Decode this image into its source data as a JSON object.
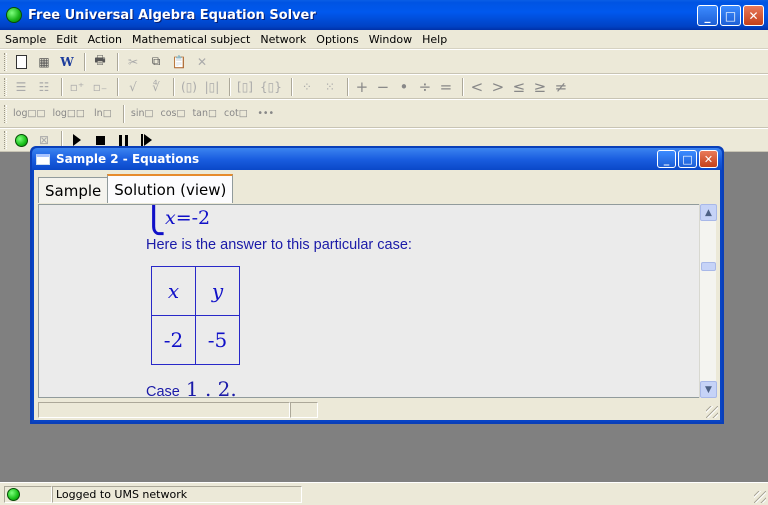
{
  "window": {
    "title": "Free Universal Algebra Equation Solver",
    "buttons": {
      "minimize": "_",
      "maximize": "□",
      "close": "✕"
    }
  },
  "menu": [
    "Sample",
    "Edit",
    "Action",
    "Mathematical subject",
    "Network",
    "Options",
    "Window",
    "Help"
  ],
  "toolbar": {
    "row1": [
      "new-document",
      "grid",
      "word-export",
      "print-preview",
      "cut",
      "copy",
      "paste",
      "delete"
    ],
    "functions": [
      "log□□",
      "log□□",
      "ln□",
      "sin□",
      "cos□",
      "tan□",
      "cot□",
      "•••"
    ],
    "operators": [
      "+",
      "−",
      "•",
      "÷",
      "=",
      "<",
      ">",
      "≤",
      "≥",
      "≠"
    ],
    "run": [
      "connect",
      "excel",
      "play",
      "stop",
      "pause",
      "step"
    ]
  },
  "child_window": {
    "title": "Sample 2 - Equations",
    "tabs": [
      {
        "label": "Sample",
        "active": false
      },
      {
        "label": "Solution (view)",
        "active": true
      }
    ],
    "equation": {
      "var": "x",
      "op": "=",
      "value": "-2"
    },
    "answer_text": "Here is the answer to this particular case:",
    "table": {
      "headers": [
        "x",
        "y"
      ],
      "values": [
        "-2",
        "-5"
      ]
    },
    "case_label": "Case",
    "case_number": "1 . 2."
  },
  "status": {
    "text": "Logged to UMS network",
    "connected_color": "#18c018"
  }
}
